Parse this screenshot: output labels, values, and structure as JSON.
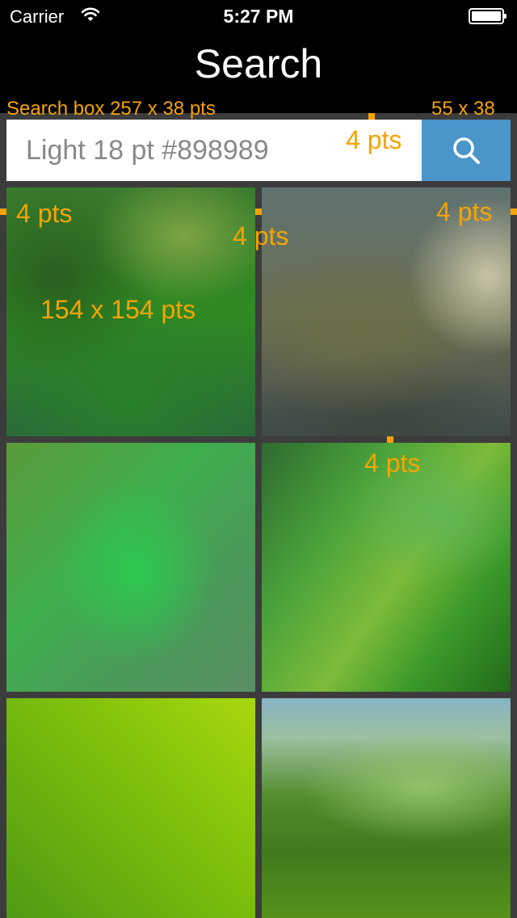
{
  "status_bar": {
    "carrier": "Carrier",
    "time": "5:27 PM",
    "wifi_icon": "wifi-icon",
    "battery_icon": "battery-icon",
    "battery_level": 1.0
  },
  "nav": {
    "title": "Search"
  },
  "search": {
    "placeholder": "Light 18 pt #898989",
    "button_icon": "search-icon"
  },
  "annotations": {
    "search_box_size": "Search box 257 x 38 pts",
    "button_size": "55 x 38",
    "gap_search": "4 pts",
    "gap_left": "4 pts",
    "gap_middle": "4 pts",
    "gap_right": "4 pts",
    "tile_size": "154 x 154 pts",
    "gap_row": "4 pts"
  },
  "grid": {
    "tiles": [
      "image-tile",
      "image-tile",
      "image-tile",
      "image-tile",
      "image-tile",
      "image-tile"
    ]
  },
  "colors": {
    "accent": "#4a96cb",
    "annotation": "#f6a400",
    "placeholder": "#898989",
    "bar": "#000000",
    "background": "#3c3c3c"
  }
}
